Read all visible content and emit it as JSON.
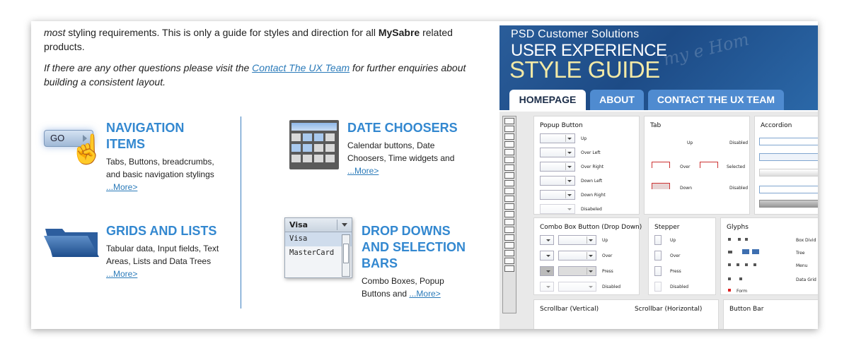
{
  "intro": {
    "line1_italic": "most",
    "line1_a": " styling requirements. This is only a guide for styles and direction for all ",
    "line1_bold": "MySabre",
    "line1_b": " related products.",
    "line2_a": "If there are any other questions please visit the ",
    "line2_link": "Contact The UX Team",
    "line2_b": " for further enquiries about building a consistent layout."
  },
  "features": {
    "navigation": {
      "title": "Navigation Items",
      "desc": "Tabs, Buttons, breadcrumbs, and basic navigation stylings",
      "more": "...More>",
      "icon_label": "GO"
    },
    "date": {
      "title": "Date Choosers",
      "desc": "Calendar buttons, Date Choosers, Time widgets and ",
      "more": "...More>"
    },
    "grids": {
      "title": "Grids and Lists",
      "desc": "Tabular data, Input fields, Text Areas, Lists and Data Trees ",
      "more": "...More>"
    },
    "dropdowns": {
      "title": "Drop Downs and Selection Bars",
      "desc": "Combo Boxes, Popup Buttons and ",
      "more": "...More>",
      "icon_selected": "Visa",
      "icon_options": [
        "Visa",
        "MasterCard"
      ]
    }
  },
  "style_guide": {
    "subtitle": "PSD Customer Solutions",
    "title1": "USER EXPERIENCE",
    "title2": "STYLE GUIDE",
    "scribble": "my  e  Hom",
    "tabs": [
      {
        "label": "HOMEPAGE",
        "active": true
      },
      {
        "label": "ABOUT",
        "active": false
      },
      {
        "label": "CONTACT THE UX TEAM",
        "active": false
      }
    ],
    "panels": {
      "popup": {
        "title": "Popup Button",
        "states": [
          "Up",
          "Over Left",
          "Over Right",
          "Down Left",
          "Down Right",
          "Disabeled"
        ]
      },
      "tab": {
        "title": "Tab",
        "states": [
          "Up",
          "Disabled",
          "Over",
          "Selected",
          "Down",
          "Disabled"
        ]
      },
      "accordion": {
        "title": "Accordion"
      },
      "combo": {
        "title": "Combo Box Button (Drop Down)",
        "states": [
          "Up",
          "Over",
          "Press",
          "Disabled"
        ]
      },
      "stepper": {
        "title": "Stepper",
        "states": [
          "Up",
          "Over",
          "Press",
          "Disabled"
        ]
      },
      "glyphs": {
        "title": "Glyphs",
        "labels": [
          "Box Divid",
          "Tree",
          "Menu",
          "Data Grid",
          "Form"
        ]
      },
      "scroll_v": {
        "title": "Scrollbar (Vertical)"
      },
      "scroll_h": {
        "title": "Scrollbar (Horizontal)"
      },
      "button_bar": {
        "title": "Button Bar"
      }
    }
  },
  "colors": {
    "accent": "#3388d0",
    "link": "#2a7ab9",
    "banner": "#1d4b86",
    "tab_inactive": "#4f8bd0"
  }
}
